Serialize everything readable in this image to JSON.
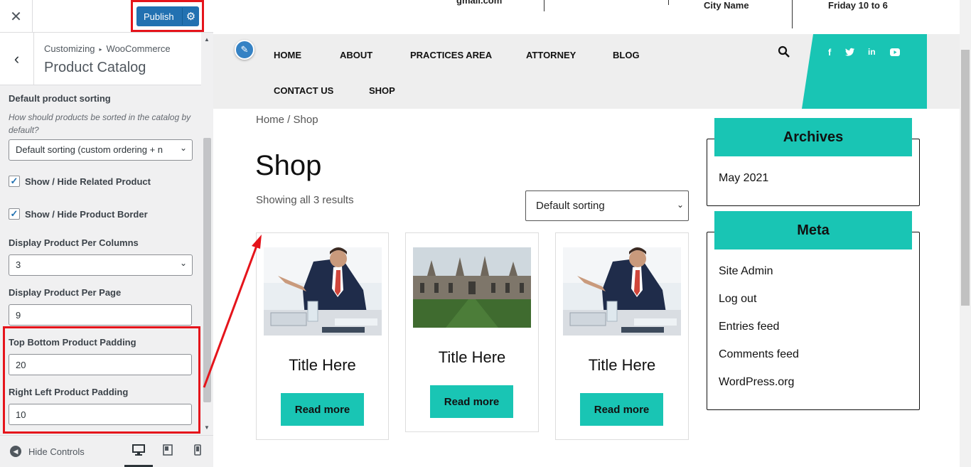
{
  "customizer": {
    "close_icon": "close-icon",
    "publish_label": "Publish",
    "breadcrumb": [
      "Customizing",
      "WooCommerce"
    ],
    "section_title": "Product Catalog",
    "controls": {
      "sorting_label": "Default product sorting",
      "sorting_desc": "How should products be sorted in the catalog by default?",
      "sorting_value": "Default sorting (custom ordering + n",
      "related_label": "Show / Hide Related Product",
      "related_checked": true,
      "border_label": "Show / Hide Product Border",
      "border_checked": true,
      "columns_label": "Display Product Per Columns",
      "columns_value": "3",
      "per_page_label": "Display Product Per Page",
      "per_page_value": "9",
      "tb_padding_label": "Top Bottom Product Padding",
      "tb_padding_value": "20",
      "rl_padding_label": "Right Left Product Padding",
      "rl_padding_value": "10"
    },
    "footer": {
      "hide_controls": "Hide Controls",
      "devices": [
        "desktop-icon",
        "tablet-icon",
        "mobile-icon"
      ],
      "active_device": "desktop"
    }
  },
  "preview": {
    "topinfo": {
      "email_fragment": "gmail.com",
      "city": "City Name",
      "hours": "Friday 10 to 6"
    },
    "nav": [
      "HOME",
      "ABOUT",
      "PRACTICES AREA",
      "ATTORNEY",
      "BLOG",
      "CONTACT US",
      "SHOP"
    ],
    "social": [
      "facebook-icon",
      "twitter-icon",
      "linkedin-icon",
      "youtube-icon"
    ],
    "breadcrumb": {
      "home": "Home",
      "sep": " / ",
      "current": "Shop"
    },
    "page_title": "Shop",
    "results_text": "Showing all 3 results",
    "sort_value": "Default sorting",
    "products": [
      {
        "title": "Title Here",
        "button": "Read more",
        "image": "businessman-photo"
      },
      {
        "title": "Title Here",
        "button": "Read more",
        "image": "college-building-photo"
      },
      {
        "title": "Title Here",
        "button": "Read more",
        "image": "businessman-photo"
      }
    ],
    "widgets": {
      "archives": {
        "title": "Archives",
        "links": [
          "May 2021"
        ]
      },
      "meta": {
        "title": "Meta",
        "links": [
          "Site Admin",
          "Log out",
          "Entries feed",
          "Comments feed",
          "WordPress.org"
        ]
      }
    },
    "colors": {
      "accent": "#19c5b4",
      "publish": "#2271b1",
      "annotation": "#e5141b"
    }
  }
}
